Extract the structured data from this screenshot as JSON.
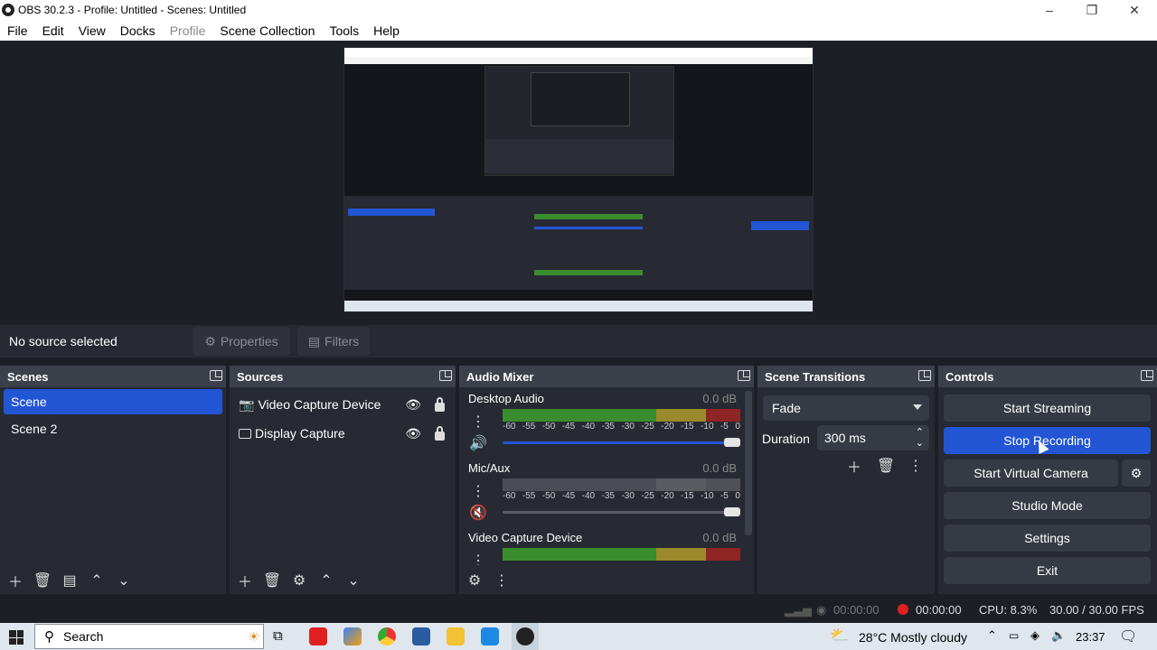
{
  "window": {
    "title": "OBS 30.2.3 - Profile: Untitled - Scenes: Untitled"
  },
  "menu": [
    "File",
    "Edit",
    "View",
    "Docks",
    "Profile",
    "Scene Collection",
    "Tools",
    "Help"
  ],
  "context_bar": {
    "no_source": "No source selected",
    "properties_label": "Properties",
    "filters_label": "Filters"
  },
  "scenes": {
    "title": "Scenes",
    "items": [
      {
        "label": "Scene",
        "selected": true
      },
      {
        "label": "Scene 2",
        "selected": false
      }
    ]
  },
  "sources": {
    "title": "Sources",
    "items": [
      {
        "label": "Video Capture Device",
        "icon": "camera-icon"
      },
      {
        "label": "Display Capture",
        "icon": "monitor-icon"
      }
    ]
  },
  "mixer": {
    "title": "Audio Mixer",
    "channels": [
      {
        "name": "Desktop Audio",
        "db": "0.0 dB",
        "muted": false
      },
      {
        "name": "Mic/Aux",
        "db": "0.0 dB",
        "muted": true
      },
      {
        "name": "Video Capture Device",
        "db": "0.0 dB",
        "muted": false
      }
    ],
    "ticks": [
      "-60",
      "-55",
      "-50",
      "-45",
      "-40",
      "-35",
      "-30",
      "-25",
      "-20",
      "-15",
      "-10",
      "-5",
      "0"
    ]
  },
  "transitions": {
    "title": "Scene Transitions",
    "selected": "Fade",
    "duration_label": "Duration",
    "duration_value": "300 ms"
  },
  "controls": {
    "title": "Controls",
    "start_streaming": "Start Streaming",
    "stop_recording": "Stop Recording",
    "start_virtual_camera": "Start Virtual Camera",
    "studio_mode": "Studio Mode",
    "settings": "Settings",
    "exit": "Exit"
  },
  "status": {
    "stream_time": "00:00:00",
    "rec_time": "00:00:00",
    "cpu": "CPU: 8.3%",
    "fps": "30.00 / 30.00 FPS"
  },
  "taskbar": {
    "search": "Search",
    "weather": "28°C  Mostly cloudy",
    "clock": "23:37"
  },
  "colors": {
    "accent": "#2356d5",
    "panel": "#272a33",
    "header": "#3c404b",
    "background": "#1d1f26"
  }
}
